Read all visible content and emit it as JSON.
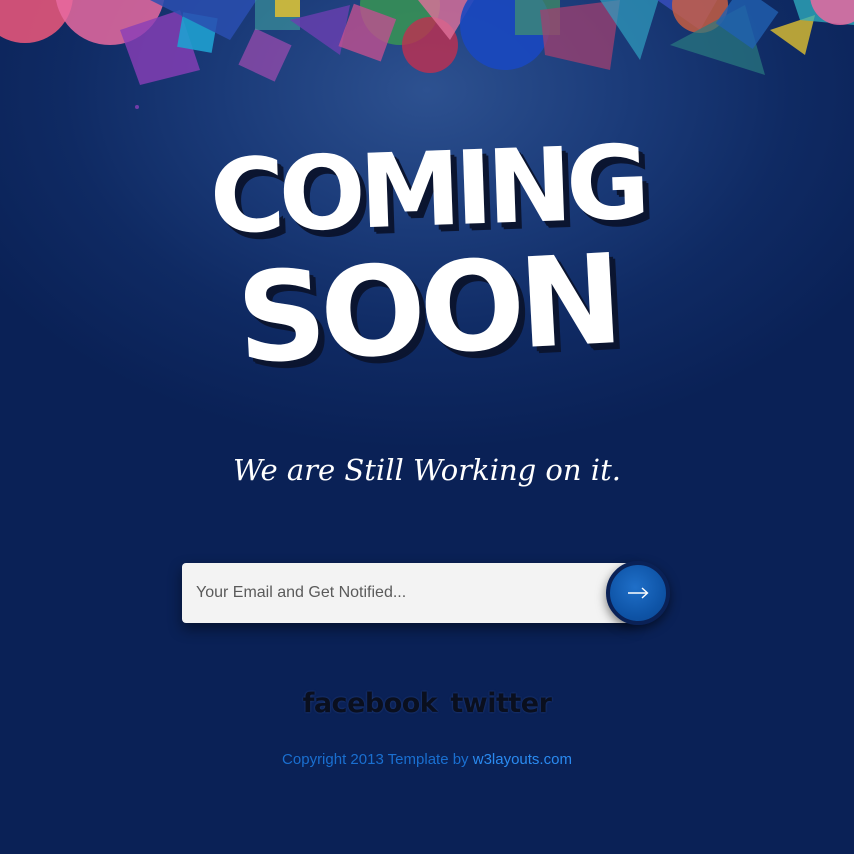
{
  "hero": {
    "line1": "COMING",
    "line2": "SOON"
  },
  "tagline": "We are Still Working on it.",
  "subscribe": {
    "placeholder": "Your Email and Get Notified...",
    "submit_icon": "arrow-right-icon"
  },
  "social": {
    "facebook": "facebook",
    "twitter": "twitter"
  },
  "footer": {
    "text": "Copyright 2013 Template by",
    "link": "w3layouts.com"
  },
  "colors": {
    "background": "#0f2a63",
    "accent": "#0f55a8",
    "footer_text": "#1a6fd0",
    "footer_link": "#2a8af0"
  }
}
